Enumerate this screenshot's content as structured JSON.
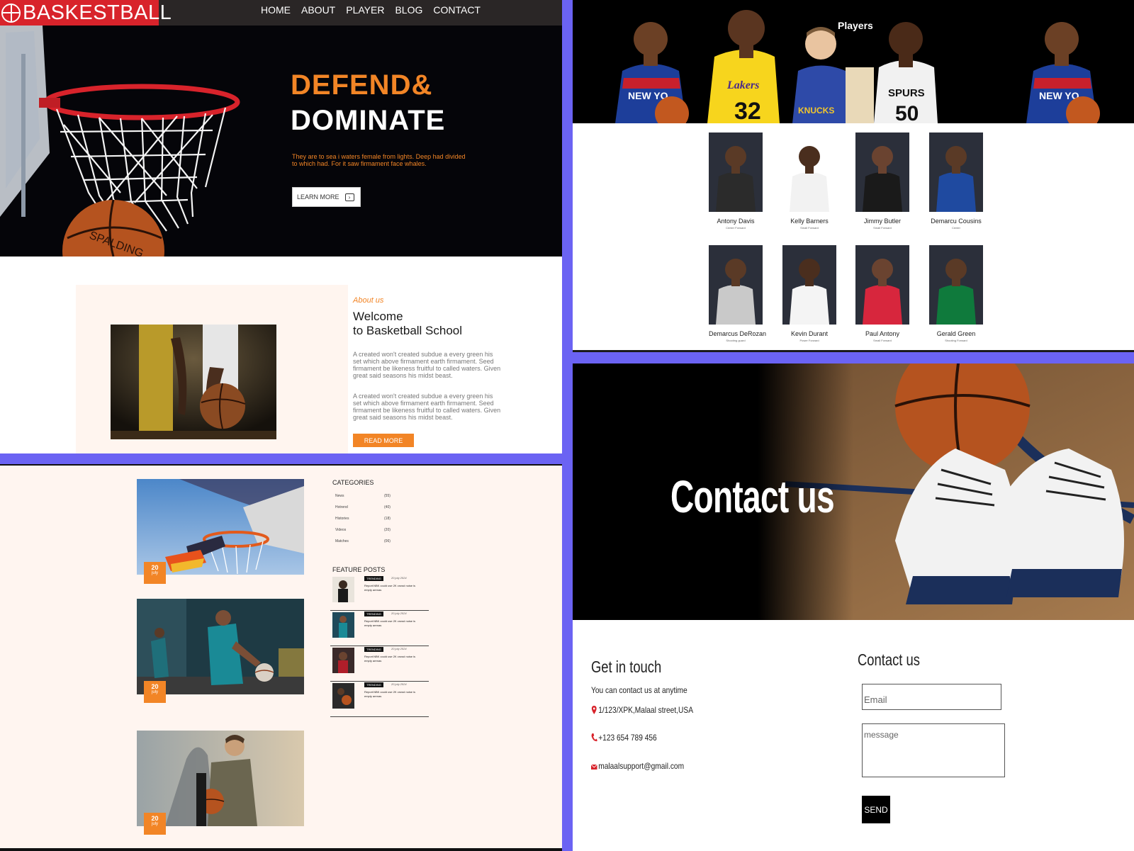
{
  "header": {
    "logo_text": "BASKESTBALL",
    "nav": [
      "HOME",
      "ABOUT",
      "PLAYER",
      "BLOG",
      "CONTACT"
    ]
  },
  "hero": {
    "title_line1": "DEFEND&",
    "title_line2": "DOMINATE",
    "text": "They are to sea i waters female from lights. Deep had divided to which had. For it saw firmament face whales.",
    "button": "LEARN MORE"
  },
  "about": {
    "subtitle": "About us",
    "title_line1": "Welcome",
    "title_line2": "to Basketball School",
    "para1": "A created won't created subdue a every green his set which above firmament earth firmament. Seed firmament be likeness fruitful to called waters. Given great said seasons his midst beast.",
    "para2": "A created won't created subdue a every green his set which above firmament earth firmament. Seed firmament be likeness fruitful to called waters. Given great said seasons his midst beast.",
    "button": "READ MORE"
  },
  "blog": {
    "cards": [
      {
        "day": "20",
        "month": "july"
      },
      {
        "day": "20",
        "month": "july"
      },
      {
        "day": "20",
        "month": "july"
      }
    ],
    "categories_title": "CATEGORIES",
    "categories": [
      {
        "name": "News",
        "count": "(55)"
      },
      {
        "name": "Hotrend",
        "count": "(40)"
      },
      {
        "name": "Histories",
        "count": "(18)"
      },
      {
        "name": "Videos",
        "count": "(20)"
      },
      {
        "name": "Matches",
        "count": "(06)"
      }
    ],
    "featured_title": "FEATURE POSTS",
    "featured": [
      {
        "tag": "TRENDING",
        "date": "20 july 2024",
        "text": "Report:NBK could use 2K crowd noise is empty arenas"
      },
      {
        "tag": "TRENDING",
        "date": "20 july 2024",
        "text": "Report:NBK could use 2K crowd noise is empty arenas"
      },
      {
        "tag": "TRENDING",
        "date": "20 july 2024",
        "text": "Report:NBK could use 2K crowd noise is empty arenas"
      },
      {
        "tag": "TRENDING",
        "date": "20 july 2024",
        "text": "Report:NBK could use 2K crowd noise is empty arenas"
      }
    ]
  },
  "players": {
    "heading": "Players",
    "list": [
      {
        "name": "Antony Davis",
        "role": "Center Forward",
        "jersey": "#2b2b2b",
        "skin": "#5a3a26"
      },
      {
        "name": "Kelly Barners",
        "role": "Small Forward",
        "jersey": "#f2f2f2",
        "skin": "#4a2e1e"
      },
      {
        "name": "Jimmy Butler",
        "role": "Small Forward",
        "jersey": "#1a1a1a",
        "skin": "#6a4330"
      },
      {
        "name": "Demarcu Cousins",
        "role": "Center",
        "jersey": "#1f4aa0",
        "skin": "#5a3a26"
      },
      {
        "name": "Demarcus DeRozan",
        "role": "Shooting guard",
        "jersey": "#c9c9c9",
        "skin": "#5a3a26"
      },
      {
        "name": "Kevin Durant",
        "role": "Power Forward",
        "jersey": "#f4f4f4",
        "skin": "#4a2e1e"
      },
      {
        "name": "Paul Antony",
        "role": "Small Forward",
        "jersey": "#d7263d",
        "skin": "#6a4330"
      },
      {
        "name": "Gerald Green",
        "role": "Shooting Forward",
        "jersey": "#0f7a3c",
        "skin": "#5a3a26"
      }
    ]
  },
  "contact": {
    "hero_title": "Contact us",
    "get_in_touch": "Get in touch",
    "sub": "You can contact us at anytime",
    "address": "1/123/XPK,Malaal street,USA",
    "phone": "+123 654 789 456",
    "email": "malaalsupport@gmail.com",
    "form_title": "Contact us",
    "email_placeholder": "Email",
    "message_placeholder": "message",
    "send": "SEND"
  },
  "colors": {
    "accent": "#f28526",
    "brand_red": "#d8232b",
    "divider": "#6b63f3"
  }
}
